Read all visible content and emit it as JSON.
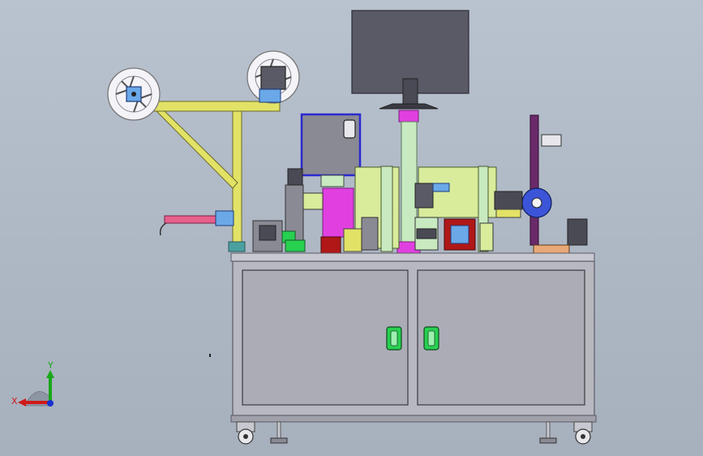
{
  "viewport": {
    "background_top": "#b9c2cf",
    "background_bottom": "#a7b0bd"
  },
  "triad": {
    "x_label": "X",
    "y_label": "Y",
    "x_color": "#d01818",
    "y_color": "#18a818",
    "z_color": "#1830d0"
  },
  "colors": {
    "cabinet": "#b8b8c0",
    "cabinet_edge": "#5a5a66",
    "frame_yellow": "#e2e266",
    "monitor": "#5a5a66",
    "magenta": "#e040e0",
    "pale_green": "#c8eac0",
    "lime": "#d8ec9c",
    "handle_green": "#28d050",
    "pink_arm": "#e8608c",
    "blue_block": "#6aa8e8",
    "dark_red": "#b01818"
  }
}
